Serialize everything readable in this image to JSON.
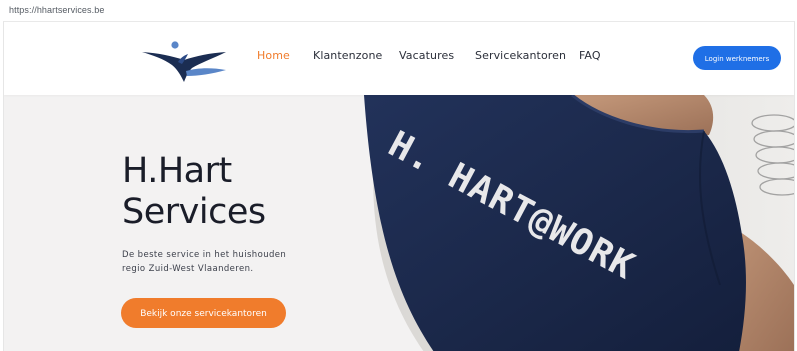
{
  "browser": {
    "url": "https://hhartservices.be"
  },
  "nav": {
    "items": [
      {
        "label": "Home",
        "active": true
      },
      {
        "label": "Klantenzone",
        "active": false
      },
      {
        "label": "Vacatures",
        "active": false
      },
      {
        "label": "Servicekantoren",
        "active": false
      },
      {
        "label": "FAQ",
        "active": false
      }
    ],
    "login_label": "Login werknemers"
  },
  "hero": {
    "title_line1": "H.Hart",
    "title_line2": "Services",
    "subtitle_line1": "De beste service in het huishouden",
    "subtitle_line2": "regio Zuid-West Vlaanderen.",
    "cta_label": "Bekijk onze servicekantoren",
    "shirt_print": "H. HART@WORK"
  },
  "colors": {
    "accent": "#f07c2c",
    "login_button": "#1f6fe6",
    "title_text": "#1a1d29",
    "shirt": "#1c2a4d",
    "logo_navy": "#1b2d52",
    "logo_blue": "#5a86c8"
  },
  "icons": {
    "logo": "h-hart-logo-figure"
  }
}
